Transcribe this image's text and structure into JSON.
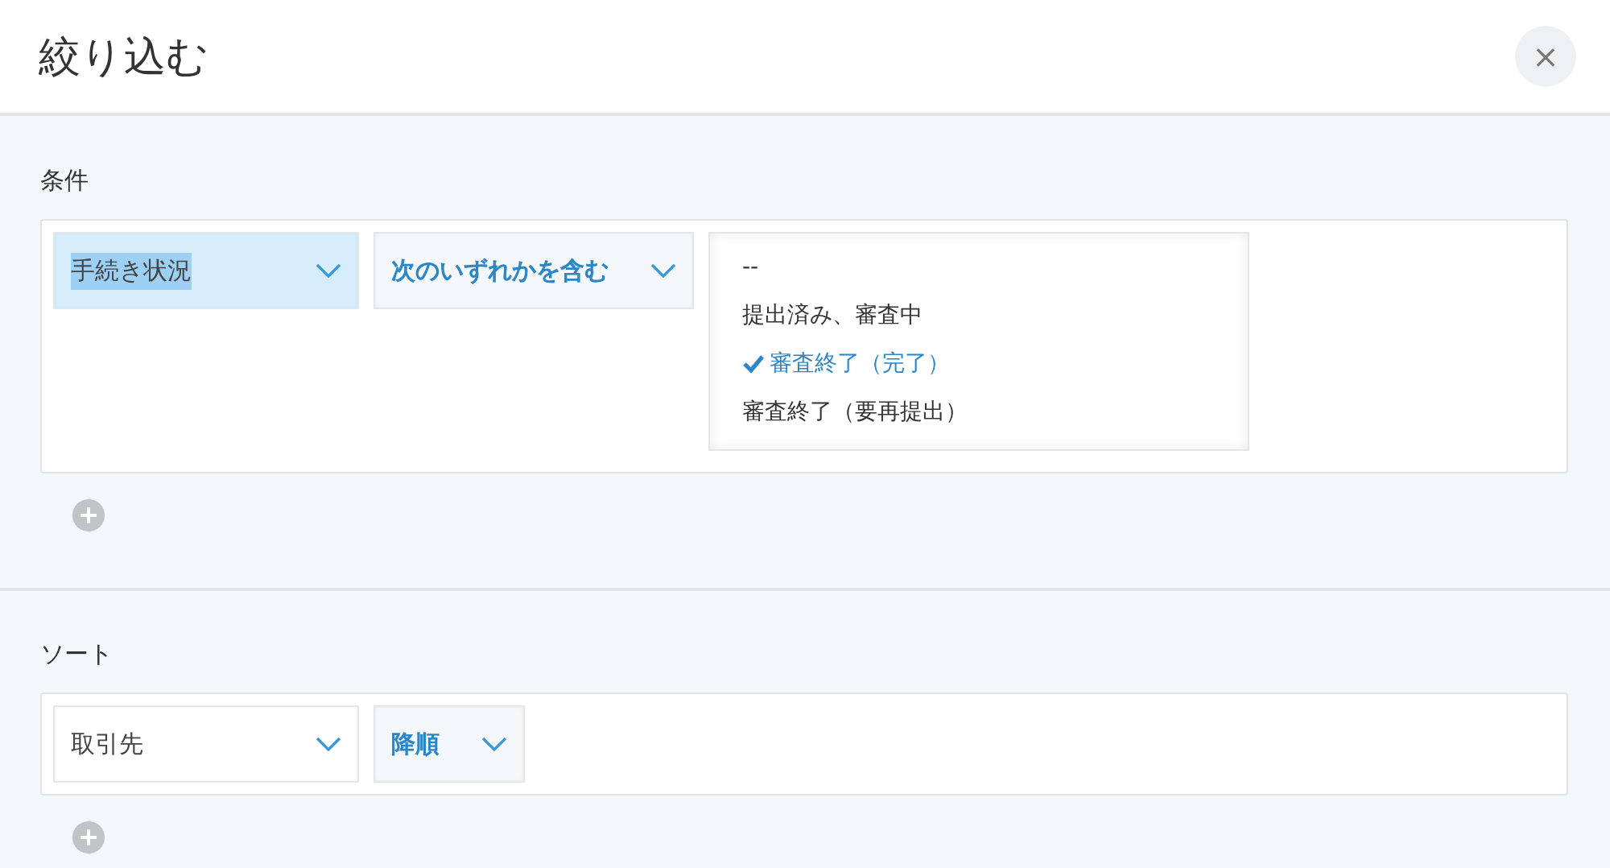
{
  "dialog": {
    "title": "絞り込む",
    "close_label": "×"
  },
  "conditions": {
    "label": "条件",
    "rows": [
      {
        "field": {
          "value": "手続き状況",
          "focused": true
        },
        "operator": {
          "value": "次のいずれかを含む",
          "focused": false
        },
        "options": [
          {
            "label": "--",
            "selected": false
          },
          {
            "label": "提出済み、審査中",
            "selected": false
          },
          {
            "label": "審査終了（完了）",
            "selected": true
          },
          {
            "label": "審査終了（要再提出）",
            "selected": false
          }
        ]
      }
    ]
  },
  "sort": {
    "label": "ソート",
    "rows": [
      {
        "field": {
          "value": "取引先",
          "focused": false
        },
        "order": {
          "value": "降順",
          "focused": false
        }
      }
    ]
  }
}
